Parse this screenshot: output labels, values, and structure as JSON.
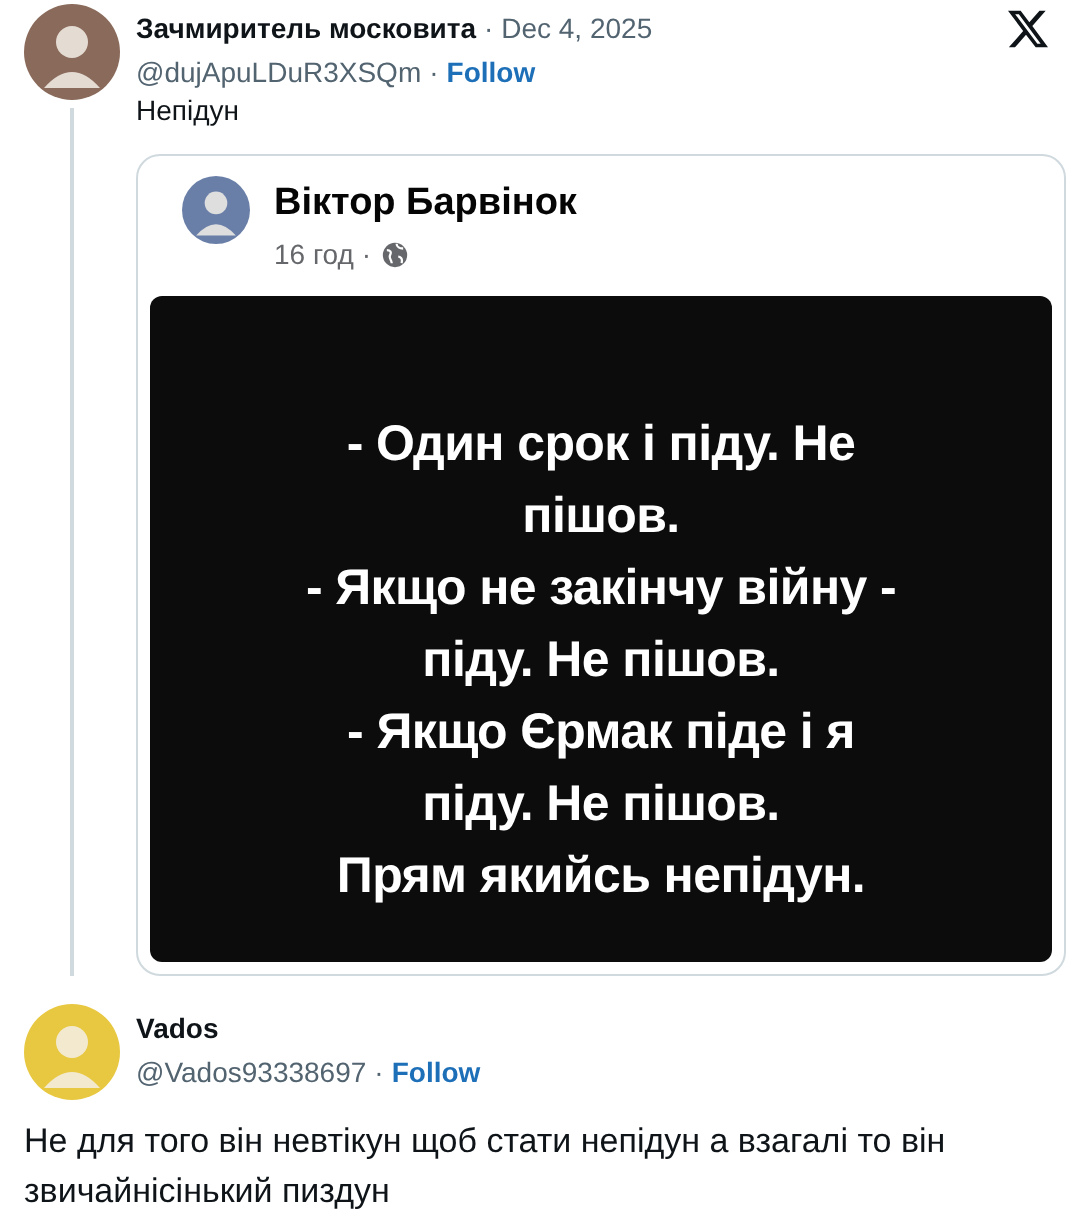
{
  "tweets": [
    {
      "name": "Зачмиритель московита",
      "date_separator": "·",
      "date": "Dec 4, 2025",
      "handle": "@dujApuLDuR3XSQm",
      "separator": "·",
      "follow": "Follow",
      "text": "Непідун",
      "embed": {
        "author": "Віктор Барвінок",
        "time": "16 год",
        "time_separator": "·",
        "post_lines": [
          "- Один срок і піду. Не",
          "пішов.",
          "- Якщо не закінчу війну -",
          "піду. Не пішов.",
          "- Якщо Єрмак піде і я",
          "піду. Не пішов.",
          "Прям якийсь непідун."
        ]
      }
    },
    {
      "name": "Vados",
      "handle": "@Vados93338697",
      "separator": "·",
      "follow": "Follow",
      "text": "Не для того він невтікун щоб стати непідун а взагалі то він звичайнісінький пиздун"
    }
  ]
}
